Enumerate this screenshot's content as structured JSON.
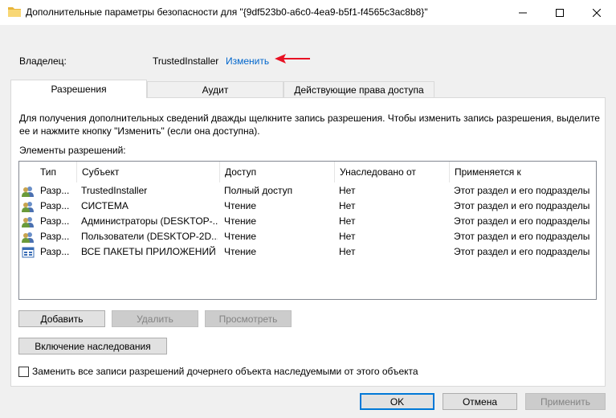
{
  "window": {
    "title": "Дополнительные параметры безопасности  для \"{9df523b0-a6c0-4ea9-b5f1-f4565c3ac8b8}\"",
    "controls": [
      "minimize-icon",
      "maximize-icon",
      "close-icon"
    ]
  },
  "owner": {
    "label": "Владелец:",
    "value": "TrustedInstaller",
    "change_link": "Изменить",
    "arrow_color": "#e81123"
  },
  "tabs": [
    {
      "label": "Разрешения",
      "active": true
    },
    {
      "label": "Аудит",
      "active": false
    },
    {
      "label": "Действующие права доступа",
      "active": false
    }
  ],
  "description": "Для получения дополнительных сведений дважды щелкните запись разрешения. Чтобы изменить запись разрешения, выделите ее и нажмите кнопку \"Изменить\" (если она доступна).",
  "elements_label": "Элементы разрешений:",
  "table": {
    "headers": [
      "Тип",
      "Субъект",
      "Доступ",
      "Унаследовано от",
      "Применяется к"
    ],
    "rows": [
      {
        "icon": "users-icon",
        "type": "Разр...",
        "subject": "TrustedInstaller",
        "access": "Полный доступ",
        "inherited": "Нет",
        "applies": "Этот раздел и его подразделы"
      },
      {
        "icon": "users-icon",
        "type": "Разр...",
        "subject": "СИСТЕМА",
        "access": "Чтение",
        "inherited": "Нет",
        "applies": "Этот раздел и его подразделы"
      },
      {
        "icon": "users-icon",
        "type": "Разр...",
        "subject": "Администраторы (DESKTOP-...",
        "access": "Чтение",
        "inherited": "Нет",
        "applies": "Этот раздел и его подразделы"
      },
      {
        "icon": "users-icon",
        "type": "Разр...",
        "subject": "Пользователи (DESKTOP-2D...",
        "access": "Чтение",
        "inherited": "Нет",
        "applies": "Этот раздел и его подразделы"
      },
      {
        "icon": "app-packages-icon",
        "type": "Разр...",
        "subject": "ВСЕ ПАКЕТЫ ПРИЛОЖЕНИЙ",
        "access": "Чтение",
        "inherited": "Нет",
        "applies": "Этот раздел и его подразделы"
      }
    ]
  },
  "buttons": {
    "add": "Добавить",
    "remove": "Удалить",
    "view": "Просмотреть",
    "enable_inheritance": "Включение наследования"
  },
  "replace_checkbox": {
    "label": "Заменить все записи разрешений дочернего объекта наследуемыми от этого объекта",
    "checked": false
  },
  "dialog_buttons": {
    "ok": "OK",
    "cancel": "Отмена",
    "apply": "Применить"
  }
}
